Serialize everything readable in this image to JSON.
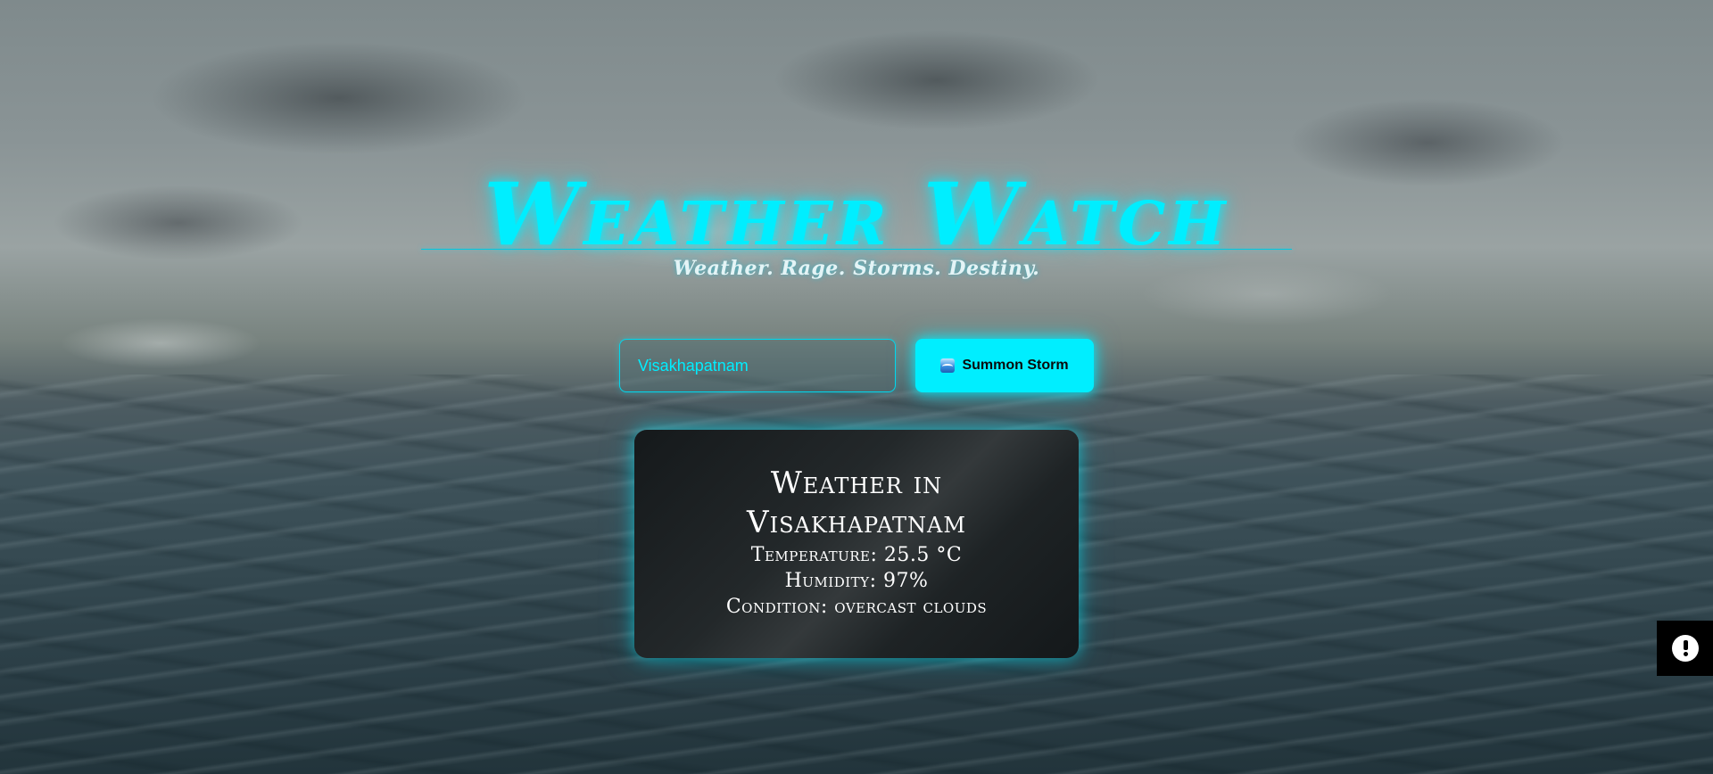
{
  "header": {
    "title": "Weather Watch",
    "tagline": "Weather. Rage. Storms. Destiny."
  },
  "search": {
    "value": "Visakhapatnam",
    "placeholder": "Enter city",
    "button_label": "Summon Storm",
    "button_icon": "water-wave-icon"
  },
  "weather": {
    "title": "Weather in Visakhapatnam",
    "temperature": "Temperature: 25.5 °C",
    "humidity": "Humidity: 97%",
    "condition": "Condition: overcast clouds"
  },
  "widget": {
    "icon": "chat-alert-icon"
  },
  "colors": {
    "accent": "#00eeff",
    "card_bg": "#1e2325",
    "text": "#ffffff"
  }
}
